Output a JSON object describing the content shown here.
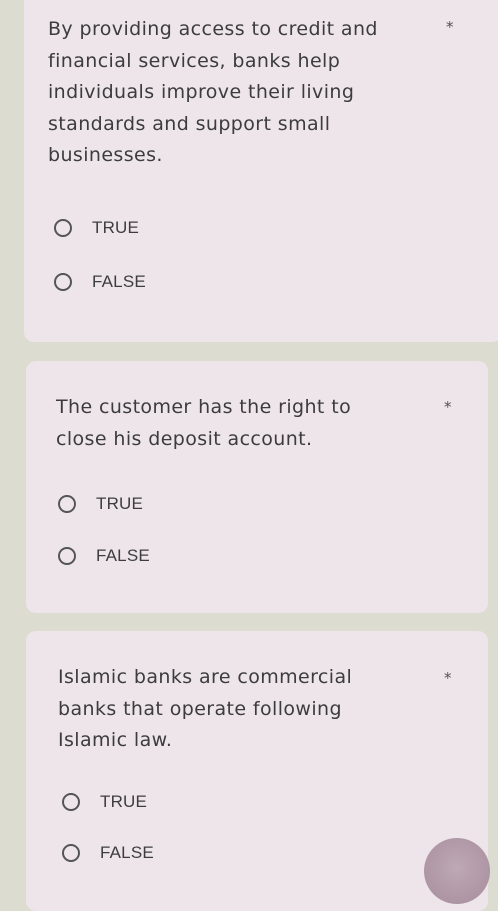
{
  "questions": [
    {
      "text_lines": [
        "By providing access to credit and",
        "financial services, banks help",
        "individuals improve their living",
        "standards and support small",
        "businesses."
      ],
      "required_mark": "*",
      "options": [
        "TRUE",
        "FALSE"
      ]
    },
    {
      "text_lines": [
        "The customer has the right to",
        "close his deposit account."
      ],
      "required_mark": "*",
      "options": [
        "TRUE",
        "FALSE"
      ]
    },
    {
      "text_lines": [
        "Islamic banks are commercial",
        "banks that operate following",
        "Islamic law."
      ],
      "required_mark": "*",
      "options": [
        "TRUE",
        "FALSE"
      ]
    }
  ]
}
